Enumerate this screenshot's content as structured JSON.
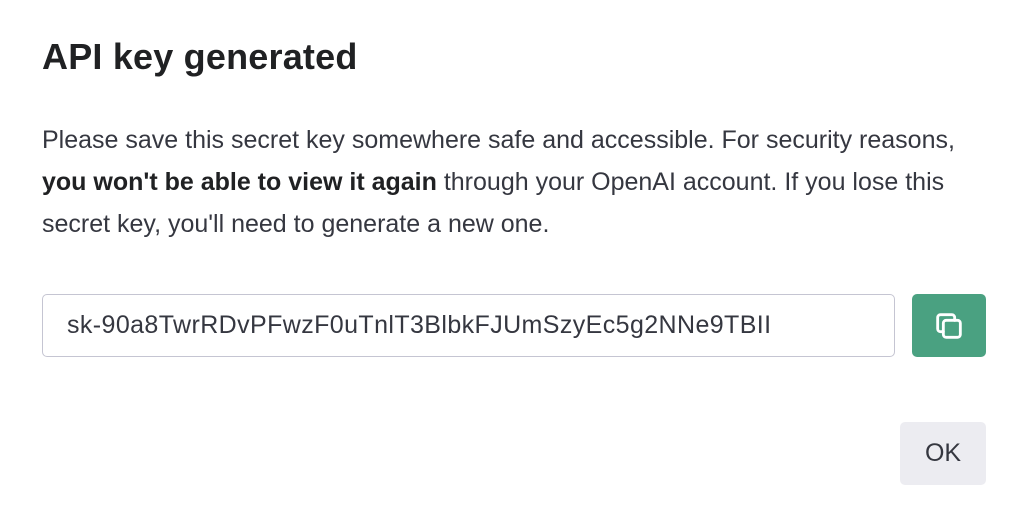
{
  "dialog": {
    "title": "API key generated",
    "message_part1": "Please save this secret key somewhere safe and accessible. For security reasons, ",
    "message_bold": "you won't be able to view it again",
    "message_part2": " through your OpenAI account. If you lose this secret key, you'll need to generate a new one.",
    "secret_key_value": "sk-90a8TwrRDvPFwzF0uTnlT3BlbkFJUmSzyEc5g2NNe9TBII",
    "copy_icon": "copy-icon",
    "ok_label": "OK"
  },
  "colors": {
    "accent_green": "#4aa181",
    "ok_button_bg": "#ececf1",
    "input_border": "#c5c5d2",
    "text": "#353740",
    "title": "#202123"
  }
}
